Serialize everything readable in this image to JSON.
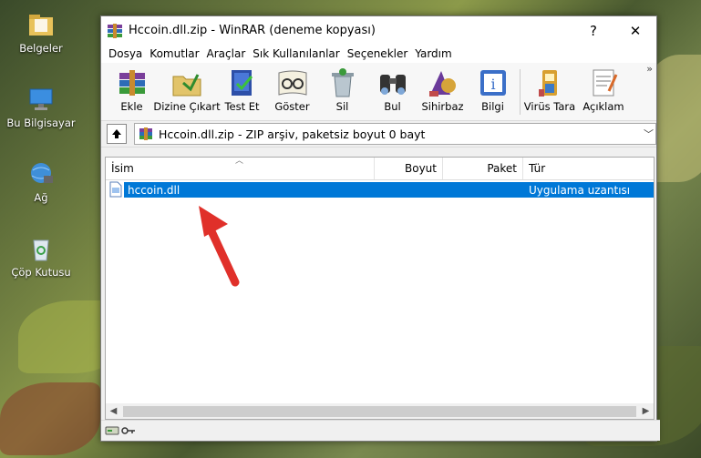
{
  "desktop": {
    "icons": [
      {
        "label": "Belgeler",
        "icon": "folder-icon"
      },
      {
        "label": "Bu Bilgisayar",
        "icon": "computer-icon"
      },
      {
        "label": "Ağ",
        "icon": "network-icon"
      },
      {
        "label": "Çöp Kutusu",
        "icon": "recycle-bin-icon"
      }
    ]
  },
  "window": {
    "title": "Hccoin.dll.zip - WinRAR (deneme kopyası)",
    "help_label": "?",
    "close_label": "✕",
    "menu": [
      "Dosya",
      "Komutlar",
      "Araçlar",
      "Sık Kullanılanlar",
      "Seçenekler",
      "Yardım"
    ],
    "toolbar": [
      {
        "label": "Ekle",
        "icon": "add-archive-icon"
      },
      {
        "label": "Dizine Çıkart",
        "icon": "extract-icon"
      },
      {
        "label": "Test Et",
        "icon": "test-icon"
      },
      {
        "label": "Göster",
        "icon": "view-icon"
      },
      {
        "label": "Sil",
        "icon": "delete-icon"
      },
      {
        "label": "Bul",
        "icon": "find-icon"
      },
      {
        "label": "Sihirbaz",
        "icon": "wizard-icon"
      },
      {
        "label": "Bilgi",
        "icon": "info-icon"
      },
      {
        "label": "Virüs Tara",
        "icon": "virus-scan-icon"
      },
      {
        "label": "Açıklam",
        "icon": "comment-icon"
      }
    ],
    "toolbar_more": "»",
    "address": "Hccoin.dll.zip - ZIP arşiv, paketsiz boyut 0 bayt",
    "columns": [
      "İsim",
      "Boyut",
      "Paket",
      "Tür"
    ],
    "files": [
      {
        "name": "hccoin.dll",
        "type": "Uygulama uzantısı",
        "selected": true
      }
    ]
  },
  "colors": {
    "selection": "#0078d7",
    "arrow": "#e0302a"
  }
}
